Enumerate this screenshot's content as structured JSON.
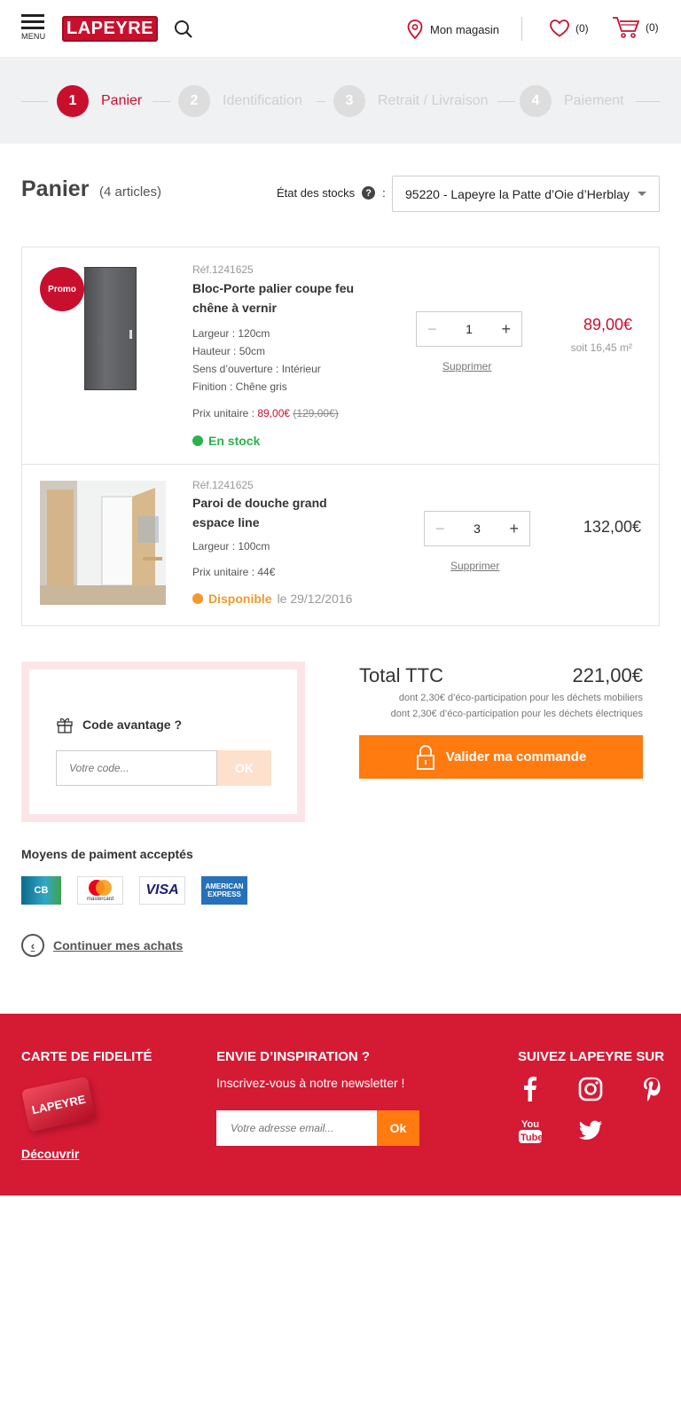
{
  "header": {
    "menu_label": "MENU",
    "logo_text": "LAPEYRE",
    "store_label": "Mon magasin",
    "wishlist_count": "(0)",
    "cart_count": "(0)"
  },
  "steps": [
    {
      "num": "1",
      "label": "Panier"
    },
    {
      "num": "2",
      "label": "Identification"
    },
    {
      "num": "3",
      "label": "Retrait / Livraison"
    },
    {
      "num": "4",
      "label": "Paiement"
    }
  ],
  "cart": {
    "title": "Panier",
    "count": "(4 articles)",
    "stock_label": "État des stocks",
    "stock_colon": ":",
    "store_selected": "95220 - Lapeyre la Patte d’Oie d’Herblay"
  },
  "items": [
    {
      "badge": "Promo",
      "ref": "Réf.1241625",
      "name": "Bloc-Porte palier coupe feu chêne à vernir",
      "attrs": [
        "Largeur : 120cm",
        "Hauteur : 50cm",
        "Sens d’ouverture : Intérieur",
        "Finition : Chêne gris"
      ],
      "unit_label": "Prix unitaire : ",
      "unit_price": "89,00€",
      "old_price": "(129,00€)",
      "stock": "En stock",
      "qty": "1",
      "minus": "−",
      "plus": "+",
      "remove": "Supprimer",
      "price": "89,00€",
      "price_sub": "soit 16,45 m²"
    },
    {
      "ref": "Réf.1241625",
      "name": "Paroi de douche grand espace line",
      "attrs": [
        "Largeur : 100cm"
      ],
      "unit_text": "Prix unitaire : 44€",
      "availability": "Disponible",
      "availability_date": "le 29/12/2016",
      "qty": "3",
      "minus": "−",
      "plus": "+",
      "remove": "Supprimer",
      "price": "132,00€"
    }
  ],
  "promo": {
    "title": "Code avantage ?",
    "placeholder": "Votre code...",
    "button": "OK"
  },
  "totals": {
    "label": "Total TTC",
    "value": "221,00€",
    "eco1": "dont 2,30€ d’éco-participation pour les déchets mobiliers",
    "eco2": "dont 2,30€ d’éco-participation pour les déchets électriques",
    "validate": "Valider ma commande"
  },
  "payment": {
    "title": "Moyens de paiment acceptés",
    "cards": [
      "CB",
      "mastercard",
      "VISA",
      "AMERICAN EXPRESS"
    ]
  },
  "continue": "Continuer mes achats",
  "footer": {
    "loyalty_title": "CARTE DE FIDELITÉ",
    "loyalty_card": "LAPEYRE",
    "discover": "Découvrir",
    "inspiration_title": "ENVIE D’INSPIRATION ?",
    "newsletter": "Inscrivez-vous à notre newsletter !",
    "email_placeholder": "Votre adresse email...",
    "email_ok": "Ok",
    "social_title": "SUIVEZ LAPEYRE SUR"
  },
  "colors": {
    "brand_red": "#c8102e",
    "orange": "#ff7a0f",
    "green": "#2bb24c",
    "footer_red": "#d51a34"
  }
}
